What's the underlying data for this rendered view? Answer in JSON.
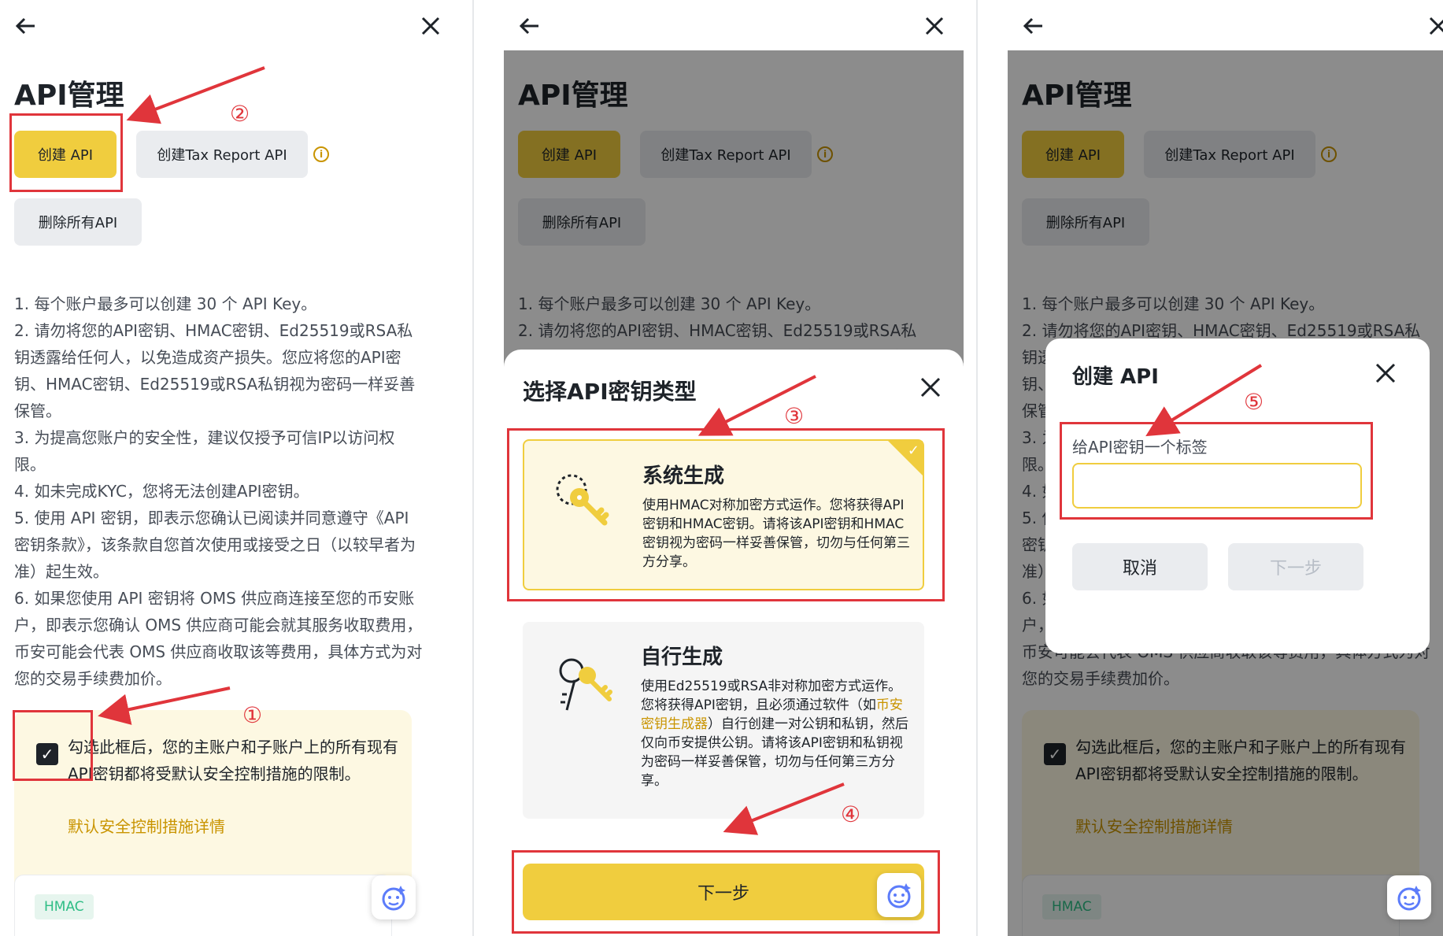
{
  "colors": {
    "accent_yellow": "#f0cd3e",
    "link_gold": "#c99400",
    "annotation_red": "#e0353b",
    "text_dark": "#1e2329",
    "hmac_green": "#2ebd85"
  },
  "common": {
    "page_title": "API管理",
    "create_api": "创建 API",
    "create_tax_api": "创建Tax Report API",
    "delete_all": "删除所有API",
    "info_glyph": "i",
    "hmac_badge": "HMAC",
    "notes": [
      "1. 每个账户最多可以创建 30 个 API Key。",
      "2. 请勿将您的API密钥、HMAC密钥、Ed25519或RSA私钥透露给任何人，以免造成资产损失。您应将您的API密钥、HMAC密钥、Ed25519或RSA私钥视为密码一样妥善保管。",
      "3. 为提高您账户的安全性，建议仅授予可信IP以访问权限。",
      "4. 如未完成KYC，您将无法创建API密钥。",
      "5. 使用 API 密钥，即表示您确认已阅读并同意遵守《API 密钥条款》，该条款自您首次使用或接受之日（以较早者为准）起生效。",
      "6. 如果您使用 API 密钥将 OMS 供应商连接至您的币安账户，即表示您确认 OMS 供应商可能会就其服务收取费用，币安可能会代表 OMS 供应商收取该等费用，具体方式为对您的交易手续费加价。"
    ],
    "consent_text": "勾选此框后，您的主账户和子账户上的所有现有API密钥都将受默认安全控制措施的限制。",
    "consent_link": "默认安全控制措施详情",
    "check_glyph": "✓"
  },
  "sheet": {
    "title": "选择API密钥类型",
    "options": [
      {
        "title": "系统生成",
        "desc": "使用HMAC对称加密方式运作。您将获得API密钥和HMAC密钥。请将该API密钥和HMAC密钥视为密码一样妥善保管，切勿与任何第三方分享。"
      },
      {
        "title": "自行生成",
        "desc_before": "使用Ed25519或RSA非对称加密方式运作。您将获得API密钥，且必须通过软件（如",
        "desc_link": "币安密钥生成器",
        "desc_after": "）自行创建一对公钥和私钥，然后仅向币安提供公钥。请将该API密钥和私钥视为密码一样妥善保管，切勿与任何第三方分享。"
      }
    ],
    "next": "下一步"
  },
  "dialog": {
    "title": "创建 API",
    "field_label": "给API密钥一个标签",
    "field_value": "",
    "cancel": "取消",
    "next": "下一步"
  },
  "annotations": [
    "①",
    "②",
    "③",
    "④",
    "⑤"
  ]
}
